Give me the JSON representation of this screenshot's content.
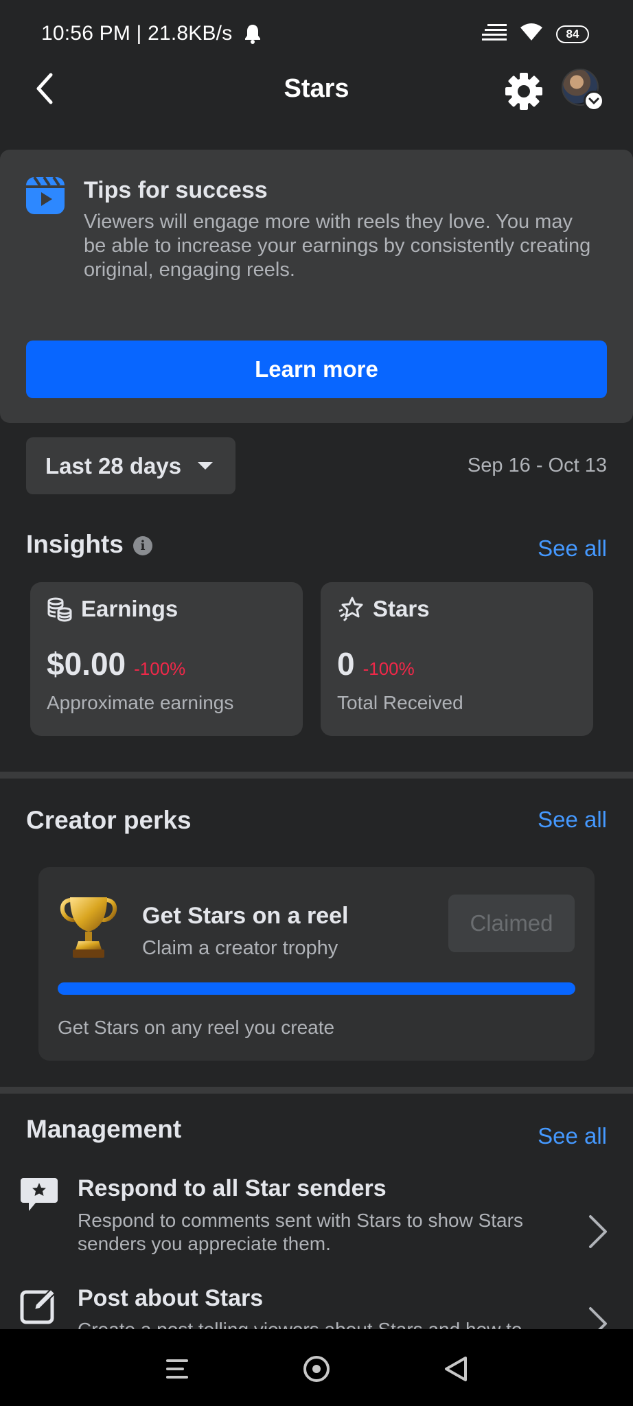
{
  "status_bar": {
    "time": "10:56 PM | 21.8KB/s",
    "battery": "84",
    "icons": [
      "bell-icon",
      "signal-icon",
      "wifi-icon",
      "battery-icon"
    ]
  },
  "header": {
    "title": "Stars",
    "back_icon": "chevron-left-icon",
    "settings_icon": "gear-icon",
    "avatar_icon": "profile-avatar"
  },
  "tips": {
    "title": "Tips for success",
    "body": "Viewers will engage more with reels they love. You may be able to increase your earnings by consistently creating original, engaging reels.",
    "button_label": "Learn more",
    "icon": "reels-icon"
  },
  "filter": {
    "selected": "Last 28 days",
    "date_range": "Sep 16 - Oct 13"
  },
  "insights": {
    "title": "Insights",
    "see_all": "See all",
    "cards": [
      {
        "label": "Earnings",
        "value": "$0.00",
        "delta": "-100%",
        "subtitle": "Approximate earnings",
        "icon": "coins-icon"
      },
      {
        "label": "Stars",
        "value": "0",
        "delta": "-100%",
        "subtitle": "Total Received",
        "icon": "stars-icon"
      }
    ]
  },
  "perks": {
    "title": "Creator perks",
    "see_all": "See all",
    "item": {
      "title": "Get Stars on a reel",
      "subtitle": "Claim a creator trophy",
      "button_label": "Claimed",
      "progress": 1.0,
      "footer": "Get Stars on any reel you create",
      "icon": "trophy-icon"
    }
  },
  "management": {
    "title": "Management",
    "see_all": "See all",
    "items": [
      {
        "title": "Respond to all Star senders",
        "description": "Respond to comments sent with Stars to show Stars senders you appreciate them.",
        "icon": "star-comment-icon"
      },
      {
        "title": "Post about Stars",
        "description": "Create a post telling viewers about Stars and how to",
        "icon": "edit-post-icon"
      }
    ]
  },
  "colors": {
    "background": "#242526",
    "card": "#3a3b3c",
    "accent": "#0866ff",
    "link": "#4599ff",
    "negative": "#f02849"
  }
}
